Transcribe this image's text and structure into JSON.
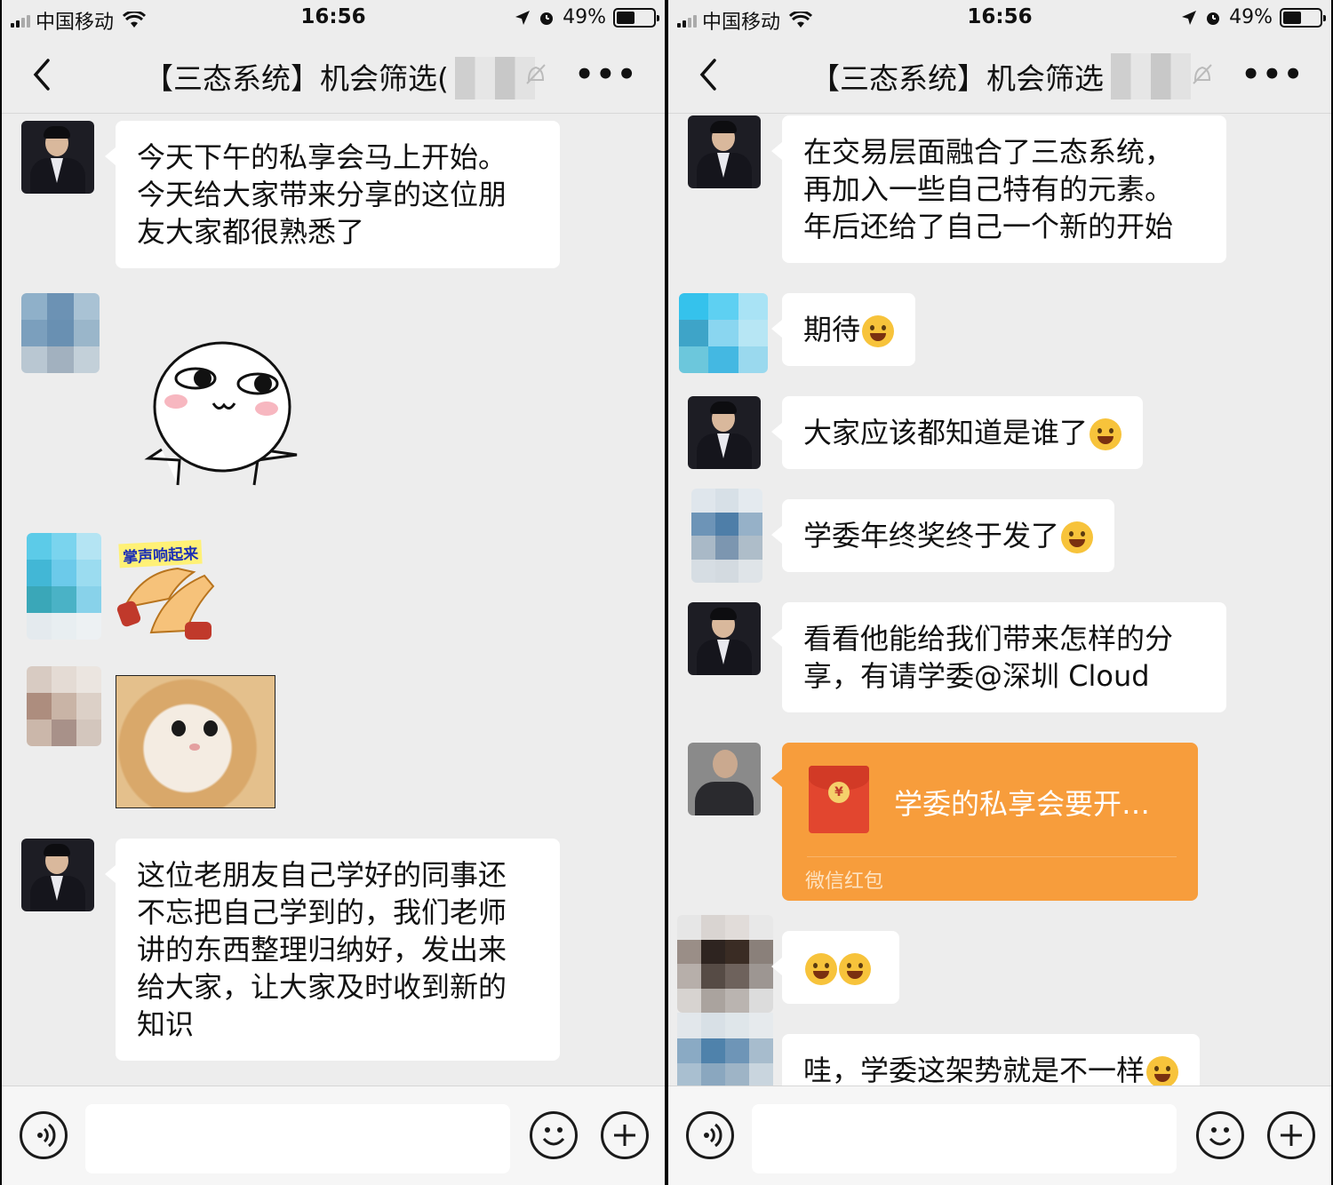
{
  "status": {
    "carrier": "中国移动",
    "time": "16:56",
    "battery": "49%",
    "battery_level": 0.49
  },
  "chat": {
    "title_left": "【三态系统】机会筛选(",
    "title_right": "【三态系统】机会筛选"
  },
  "left_messages": [
    {
      "type": "text",
      "text": "今天下午的私享会马上开始。\n今天给大家带来分享的这位朋\n友大家都很熟悉了"
    },
    {
      "type": "sticker",
      "name": "cute-face-sticker"
    },
    {
      "type": "sticker",
      "name": "applause-sticker",
      "caption": "掌声响起来"
    },
    {
      "type": "image",
      "name": "cat-image"
    },
    {
      "type": "text",
      "text": "这位老朋友自己学好的同事还\n不忘把自己学到的，我们老师\n讲的东西整理归纳好，发出来\n给大家，让大家及时收到新的\n知识"
    }
  ],
  "right_messages": [
    {
      "type": "text",
      "text": "在交易层面融合了三态系统，\n再加入一些自己特有的元素。\n年后还给了自己一个新的开始"
    },
    {
      "type": "text",
      "text": "期待",
      "emoji": "hug-emoji"
    },
    {
      "type": "text",
      "text": "大家应该都知道是谁了",
      "emoji": "grin-emoji"
    },
    {
      "type": "text",
      "text": "学委年终奖终于发了",
      "emoji": "thinking-emoji"
    },
    {
      "type": "text",
      "text": "看看他能给我们带来怎样的分\n享，有请学委@深圳 Cloud"
    },
    {
      "type": "red_packet",
      "title": "学委的私享会要开…",
      "footer": "微信红包"
    },
    {
      "type": "emoji_only",
      "emoji": "hug-emoji"
    },
    {
      "type": "text",
      "text": "哇，学委这架势就是不一样",
      "emoji": "grimace-emoji"
    }
  ],
  "colors": {
    "bg": "#ededed",
    "bubble": "#ffffff",
    "redpacket": "#f79d3c"
  }
}
